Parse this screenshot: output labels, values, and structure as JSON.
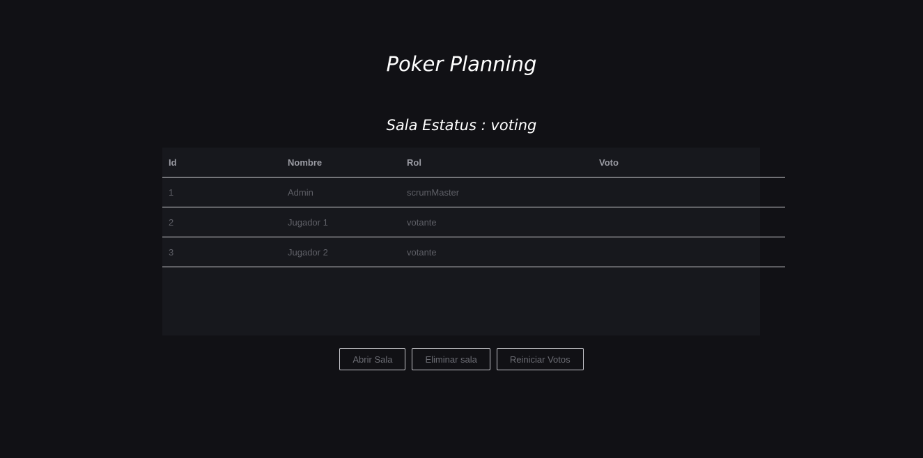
{
  "header": {
    "title": "Poker Planning",
    "status": "Sala Estatus : voting"
  },
  "table": {
    "columns": [
      "Id",
      "Nombre",
      "Rol",
      "Voto"
    ],
    "rows": [
      {
        "id": "1",
        "nombre": "Admin",
        "rol": "scrumMaster",
        "voto": ""
      },
      {
        "id": "2",
        "nombre": "Jugador 1",
        "rol": "votante",
        "voto": ""
      },
      {
        "id": "3",
        "nombre": "Jugador 2",
        "rol": "votante",
        "voto": ""
      }
    ]
  },
  "actions": {
    "open_room": "Abrir Sala",
    "delete_room": "Eliminar sala",
    "reset_votes": "Reiniciar Votos"
  },
  "colors": {
    "background": "#111115",
    "panel": "#17181d",
    "title": "#ffffff"
  }
}
